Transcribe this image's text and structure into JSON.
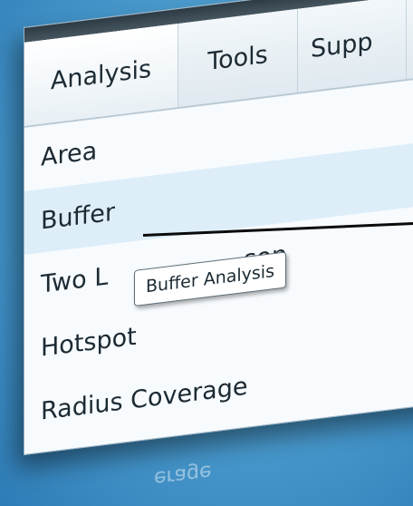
{
  "menu_bar": {
    "tabs": [
      {
        "label": "Analysis"
      },
      {
        "label": "Tools"
      },
      {
        "label": "Supp"
      }
    ]
  },
  "dropdown": {
    "items": [
      {
        "label": "Area"
      },
      {
        "label": "Buffer"
      },
      {
        "label": "Two L"
      },
      {
        "label": "Hotspot"
      },
      {
        "label": "Radius Coverage"
      }
    ],
    "partial_text": "son"
  },
  "tooltip": {
    "text": "Buffer Analysis"
  },
  "reflection_text": "erage"
}
